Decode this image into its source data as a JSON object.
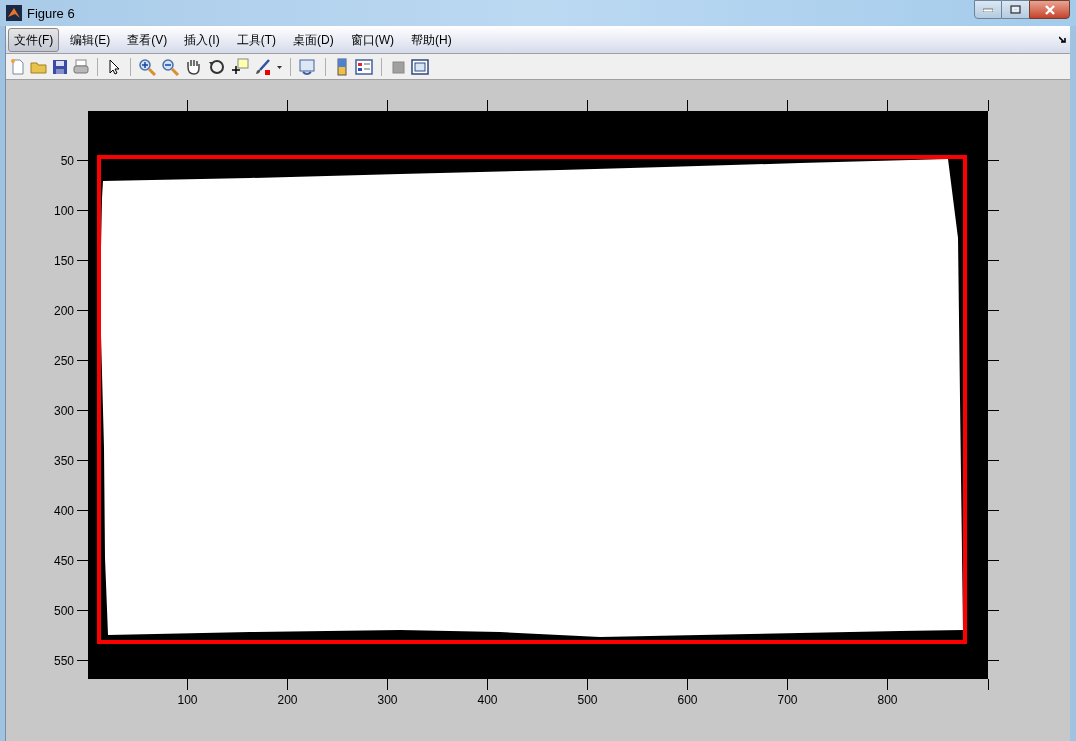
{
  "window": {
    "title": "Figure 6"
  },
  "menu": [
    {
      "label": "文件(F)",
      "selected": true
    },
    {
      "label": "编辑(E)",
      "selected": false
    },
    {
      "label": "查看(V)",
      "selected": false
    },
    {
      "label": "插入(I)",
      "selected": false
    },
    {
      "label": "工具(T)",
      "selected": false
    },
    {
      "label": "桌面(D)",
      "selected": false
    },
    {
      "label": "窗口(W)",
      "selected": false
    },
    {
      "label": "帮助(H)",
      "selected": false
    }
  ],
  "axes": {
    "xtick_labels": [
      "100",
      "200",
      "300",
      "400",
      "500",
      "600",
      "700",
      "800"
    ],
    "ytick_labels": [
      "50",
      "100",
      "150",
      "200",
      "250",
      "300",
      "350",
      "400",
      "450",
      "500",
      "550"
    ]
  }
}
